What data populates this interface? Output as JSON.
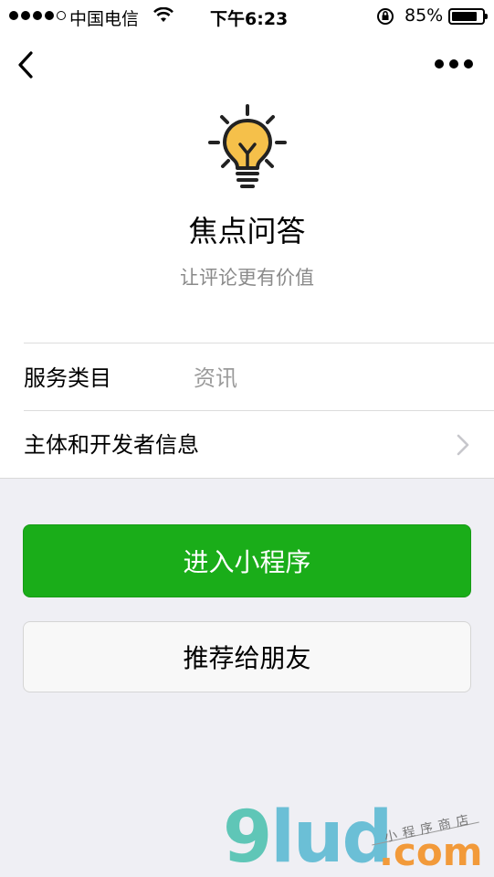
{
  "status_bar": {
    "carrier": "中国电信",
    "time": "下午6:23",
    "battery_percent_text": "85%",
    "battery_level": 0.85
  },
  "app": {
    "name": "焦点问答",
    "description": "让评论更有价值",
    "icon": "lightbulb-icon"
  },
  "info": {
    "category_label": "服务类目",
    "category_value": "资讯",
    "developer_label": "主体和开发者信息"
  },
  "actions": {
    "enter_label": "进入小程序",
    "share_label": "推荐给朋友"
  },
  "watermark": {
    "brand_9": "9",
    "brand_lud": "lud",
    "brand_com": ".com",
    "brand_sub": "小程序商店"
  },
  "colors": {
    "primary_green": "#1aad19",
    "bulb_yellow": "#f5c04a"
  }
}
